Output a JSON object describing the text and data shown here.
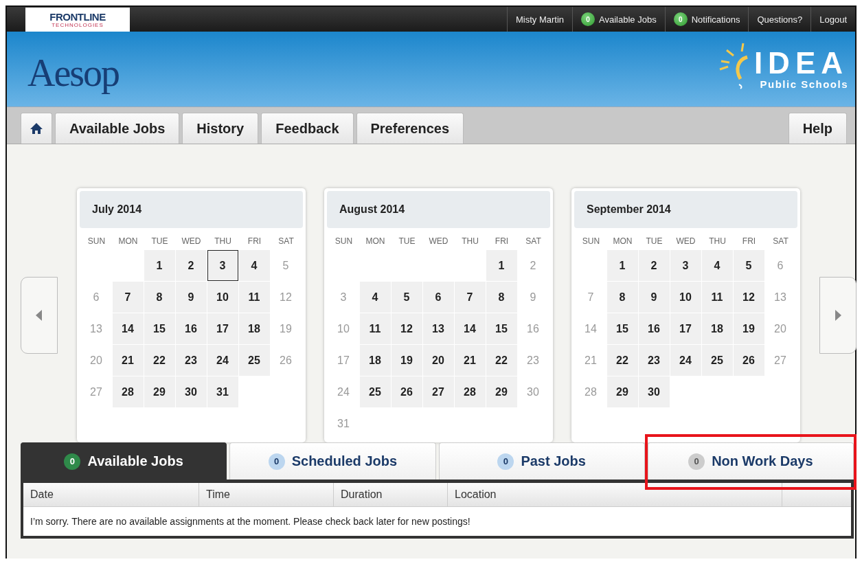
{
  "top_bar": {
    "brand": "FRONTLINE",
    "brand_sub": "TECHNOLOGIES",
    "items": [
      {
        "kind": "text",
        "label": "Misty Martin"
      },
      {
        "kind": "badge",
        "count": "0",
        "label": "Available Jobs"
      },
      {
        "kind": "badge",
        "count": "0",
        "label": "Notifications"
      },
      {
        "kind": "text",
        "label": "Questions?"
      },
      {
        "kind": "text",
        "label": "Logout"
      }
    ]
  },
  "banner": {
    "app_logo": "Aesop",
    "district": "IDEA",
    "district_sub": "Public Schools"
  },
  "nav": {
    "tabs": [
      {
        "kind": "home"
      },
      {
        "kind": "text",
        "label": "Available Jobs"
      },
      {
        "kind": "text",
        "label": "History"
      },
      {
        "kind": "text",
        "label": "Feedback"
      },
      {
        "kind": "text",
        "label": "Preferences"
      }
    ],
    "help": "Help"
  },
  "calendars": [
    {
      "title": "July 2014",
      "weekdays": [
        "SUN",
        "MON",
        "TUE",
        "WED",
        "THU",
        "FRI",
        "SAT"
      ],
      "weeks": [
        [
          {
            "kind": "blank"
          },
          {
            "kind": "blank"
          },
          {
            "day": "1",
            "kind": "work"
          },
          {
            "day": "2",
            "kind": "work"
          },
          {
            "day": "3",
            "kind": "today"
          },
          {
            "day": "4",
            "kind": "work"
          },
          {
            "day": "5",
            "kind": "off"
          }
        ],
        [
          {
            "day": "6",
            "kind": "off"
          },
          {
            "day": "7",
            "kind": "work"
          },
          {
            "day": "8",
            "kind": "work"
          },
          {
            "day": "9",
            "kind": "work"
          },
          {
            "day": "10",
            "kind": "work"
          },
          {
            "day": "11",
            "kind": "work"
          },
          {
            "day": "12",
            "kind": "off"
          }
        ],
        [
          {
            "day": "13",
            "kind": "off"
          },
          {
            "day": "14",
            "kind": "work"
          },
          {
            "day": "15",
            "kind": "work"
          },
          {
            "day": "16",
            "kind": "work"
          },
          {
            "day": "17",
            "kind": "work"
          },
          {
            "day": "18",
            "kind": "work"
          },
          {
            "day": "19",
            "kind": "off"
          }
        ],
        [
          {
            "day": "20",
            "kind": "off"
          },
          {
            "day": "21",
            "kind": "work"
          },
          {
            "day": "22",
            "kind": "work"
          },
          {
            "day": "23",
            "kind": "work"
          },
          {
            "day": "24",
            "kind": "work"
          },
          {
            "day": "25",
            "kind": "work"
          },
          {
            "day": "26",
            "kind": "off"
          }
        ],
        [
          {
            "day": "27",
            "kind": "off"
          },
          {
            "day": "28",
            "kind": "work"
          },
          {
            "day": "29",
            "kind": "work"
          },
          {
            "day": "30",
            "kind": "work"
          },
          {
            "day": "31",
            "kind": "work"
          }
        ]
      ]
    },
    {
      "title": "August 2014",
      "weekdays": [
        "SUN",
        "MON",
        "TUE",
        "WED",
        "THU",
        "FRI",
        "SAT"
      ],
      "weeks": [
        [
          {
            "kind": "blank"
          },
          {
            "kind": "blank"
          },
          {
            "kind": "blank"
          },
          {
            "kind": "blank"
          },
          {
            "kind": "blank"
          },
          {
            "day": "1",
            "kind": "work"
          },
          {
            "day": "2",
            "kind": "off"
          }
        ],
        [
          {
            "day": "3",
            "kind": "off"
          },
          {
            "day": "4",
            "kind": "work"
          },
          {
            "day": "5",
            "kind": "work"
          },
          {
            "day": "6",
            "kind": "work"
          },
          {
            "day": "7",
            "kind": "work"
          },
          {
            "day": "8",
            "kind": "work"
          },
          {
            "day": "9",
            "kind": "off"
          }
        ],
        [
          {
            "day": "10",
            "kind": "off"
          },
          {
            "day": "11",
            "kind": "work"
          },
          {
            "day": "12",
            "kind": "work"
          },
          {
            "day": "13",
            "kind": "work"
          },
          {
            "day": "14",
            "kind": "work"
          },
          {
            "day": "15",
            "kind": "work"
          },
          {
            "day": "16",
            "kind": "off"
          }
        ],
        [
          {
            "day": "17",
            "kind": "off"
          },
          {
            "day": "18",
            "kind": "work"
          },
          {
            "day": "19",
            "kind": "work"
          },
          {
            "day": "20",
            "kind": "work"
          },
          {
            "day": "21",
            "kind": "work"
          },
          {
            "day": "22",
            "kind": "work"
          },
          {
            "day": "23",
            "kind": "off"
          }
        ],
        [
          {
            "day": "24",
            "kind": "off"
          },
          {
            "day": "25",
            "kind": "work"
          },
          {
            "day": "26",
            "kind": "work"
          },
          {
            "day": "27",
            "kind": "work"
          },
          {
            "day": "28",
            "kind": "work"
          },
          {
            "day": "29",
            "kind": "work"
          },
          {
            "day": "30",
            "kind": "off"
          }
        ],
        [
          {
            "day": "31",
            "kind": "off"
          }
        ]
      ]
    },
    {
      "title": "September 2014",
      "weekdays": [
        "SUN",
        "MON",
        "TUE",
        "WED",
        "THU",
        "FRI",
        "SAT"
      ],
      "weeks": [
        [
          {
            "kind": "blank"
          },
          {
            "day": "1",
            "kind": "work"
          },
          {
            "day": "2",
            "kind": "work"
          },
          {
            "day": "3",
            "kind": "work"
          },
          {
            "day": "4",
            "kind": "work"
          },
          {
            "day": "5",
            "kind": "work"
          },
          {
            "day": "6",
            "kind": "off"
          }
        ],
        [
          {
            "day": "7",
            "kind": "off"
          },
          {
            "day": "8",
            "kind": "work"
          },
          {
            "day": "9",
            "kind": "work"
          },
          {
            "day": "10",
            "kind": "work"
          },
          {
            "day": "11",
            "kind": "work"
          },
          {
            "day": "12",
            "kind": "work"
          },
          {
            "day": "13",
            "kind": "off"
          }
        ],
        [
          {
            "day": "14",
            "kind": "off"
          },
          {
            "day": "15",
            "kind": "work"
          },
          {
            "day": "16",
            "kind": "work"
          },
          {
            "day": "17",
            "kind": "work"
          },
          {
            "day": "18",
            "kind": "work"
          },
          {
            "day": "19",
            "kind": "work"
          },
          {
            "day": "20",
            "kind": "off"
          }
        ],
        [
          {
            "day": "21",
            "kind": "off"
          },
          {
            "day": "22",
            "kind": "work"
          },
          {
            "day": "23",
            "kind": "work"
          },
          {
            "day": "24",
            "kind": "work"
          },
          {
            "day": "25",
            "kind": "work"
          },
          {
            "day": "26",
            "kind": "work"
          },
          {
            "day": "27",
            "kind": "off"
          }
        ],
        [
          {
            "day": "28",
            "kind": "off"
          },
          {
            "day": "29",
            "kind": "work"
          },
          {
            "day": "30",
            "kind": "work"
          }
        ]
      ]
    }
  ],
  "job_tabs": [
    {
      "count": "0",
      "label": "Available Jobs",
      "selected": true,
      "highlighted": false
    },
    {
      "count": "0",
      "label": "Scheduled Jobs",
      "selected": false,
      "highlighted": false
    },
    {
      "count": "0",
      "label": "Past Jobs",
      "selected": false,
      "highlighted": false
    },
    {
      "count": "0",
      "label": "Non Work Days",
      "selected": false,
      "highlighted": true,
      "muted": true
    }
  ],
  "table": {
    "columns": [
      "Date",
      "Time",
      "Duration",
      "Location"
    ],
    "empty_message": "I’m sorry. There are no available assignments at the moment. Please check back later for new postings!"
  }
}
